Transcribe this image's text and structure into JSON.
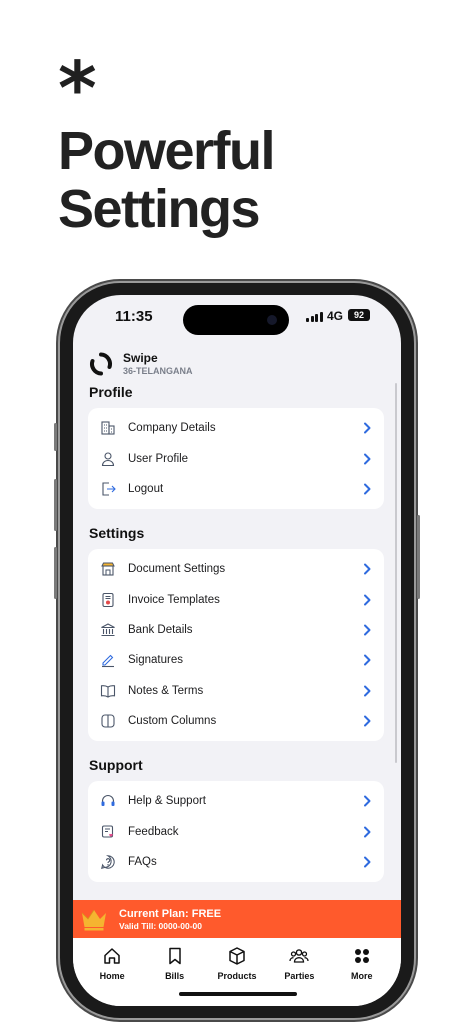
{
  "hero": {
    "asterisk": "*",
    "line1": "Powerful",
    "line2": "Settings"
  },
  "status_bar": {
    "time": "11:35",
    "network": "4G",
    "battery": "92"
  },
  "company": {
    "name": "Swipe",
    "state": "36-TELANGANA"
  },
  "sections": {
    "profile": {
      "title": "Profile",
      "items": [
        {
          "label": "Company Details",
          "icon": "building-icon"
        },
        {
          "label": "User Profile",
          "icon": "user-icon"
        },
        {
          "label": "Logout",
          "icon": "logout-icon"
        }
      ]
    },
    "settings": {
      "title": "Settings",
      "items": [
        {
          "label": "Document Settings",
          "icon": "shop-icon"
        },
        {
          "label": "Invoice Templates",
          "icon": "template-icon"
        },
        {
          "label": "Bank Details",
          "icon": "bank-icon"
        },
        {
          "label": "Signatures",
          "icon": "pen-icon"
        },
        {
          "label": "Notes & Terms",
          "icon": "book-icon"
        },
        {
          "label": "Custom Columns",
          "icon": "columns-icon"
        }
      ]
    },
    "support": {
      "title": "Support",
      "items": [
        {
          "label": "Help & Support",
          "icon": "headset-icon"
        },
        {
          "label": "Feedback",
          "icon": "feedback-icon"
        },
        {
          "label": "FAQs",
          "icon": "question-icon"
        }
      ]
    }
  },
  "plan_banner": {
    "title": "Current Plan: FREE",
    "valid": "Valid Till: 0000-00-00"
  },
  "tabbar": {
    "home": "Home",
    "bills": "Bills",
    "products": "Products",
    "parties": "Parties",
    "more": "More"
  },
  "colors": {
    "accent": "#2f6bdf",
    "banner": "#ff5a2c",
    "crown": "#f5b430",
    "background": "#f2f2f6"
  }
}
